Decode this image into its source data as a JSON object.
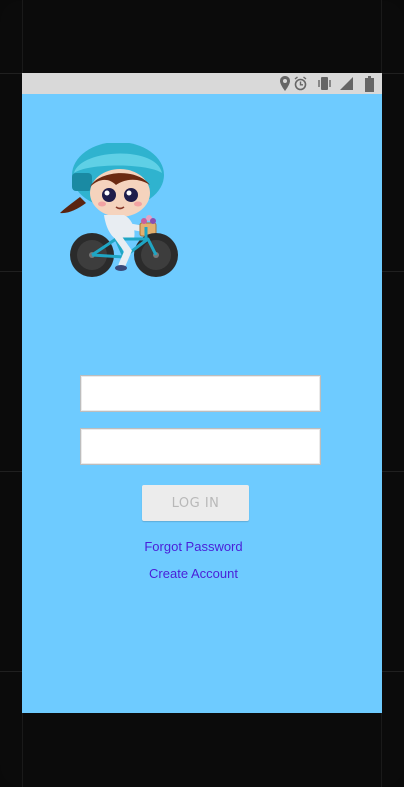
{
  "status_bar": {
    "icons": [
      "location-icon",
      "alarm-icon",
      "vibrate-icon",
      "signal-icon",
      "battery-icon"
    ]
  },
  "login": {
    "email_value": "",
    "password_value": "",
    "login_label": "LOG IN",
    "forgot_label": "Forgot Password",
    "create_label": "Create Account"
  },
  "colors": {
    "screen_bg": "#6ecbff",
    "link": "#4a1fd8",
    "button_bg": "#ececec",
    "button_text": "#b8b8b8"
  }
}
